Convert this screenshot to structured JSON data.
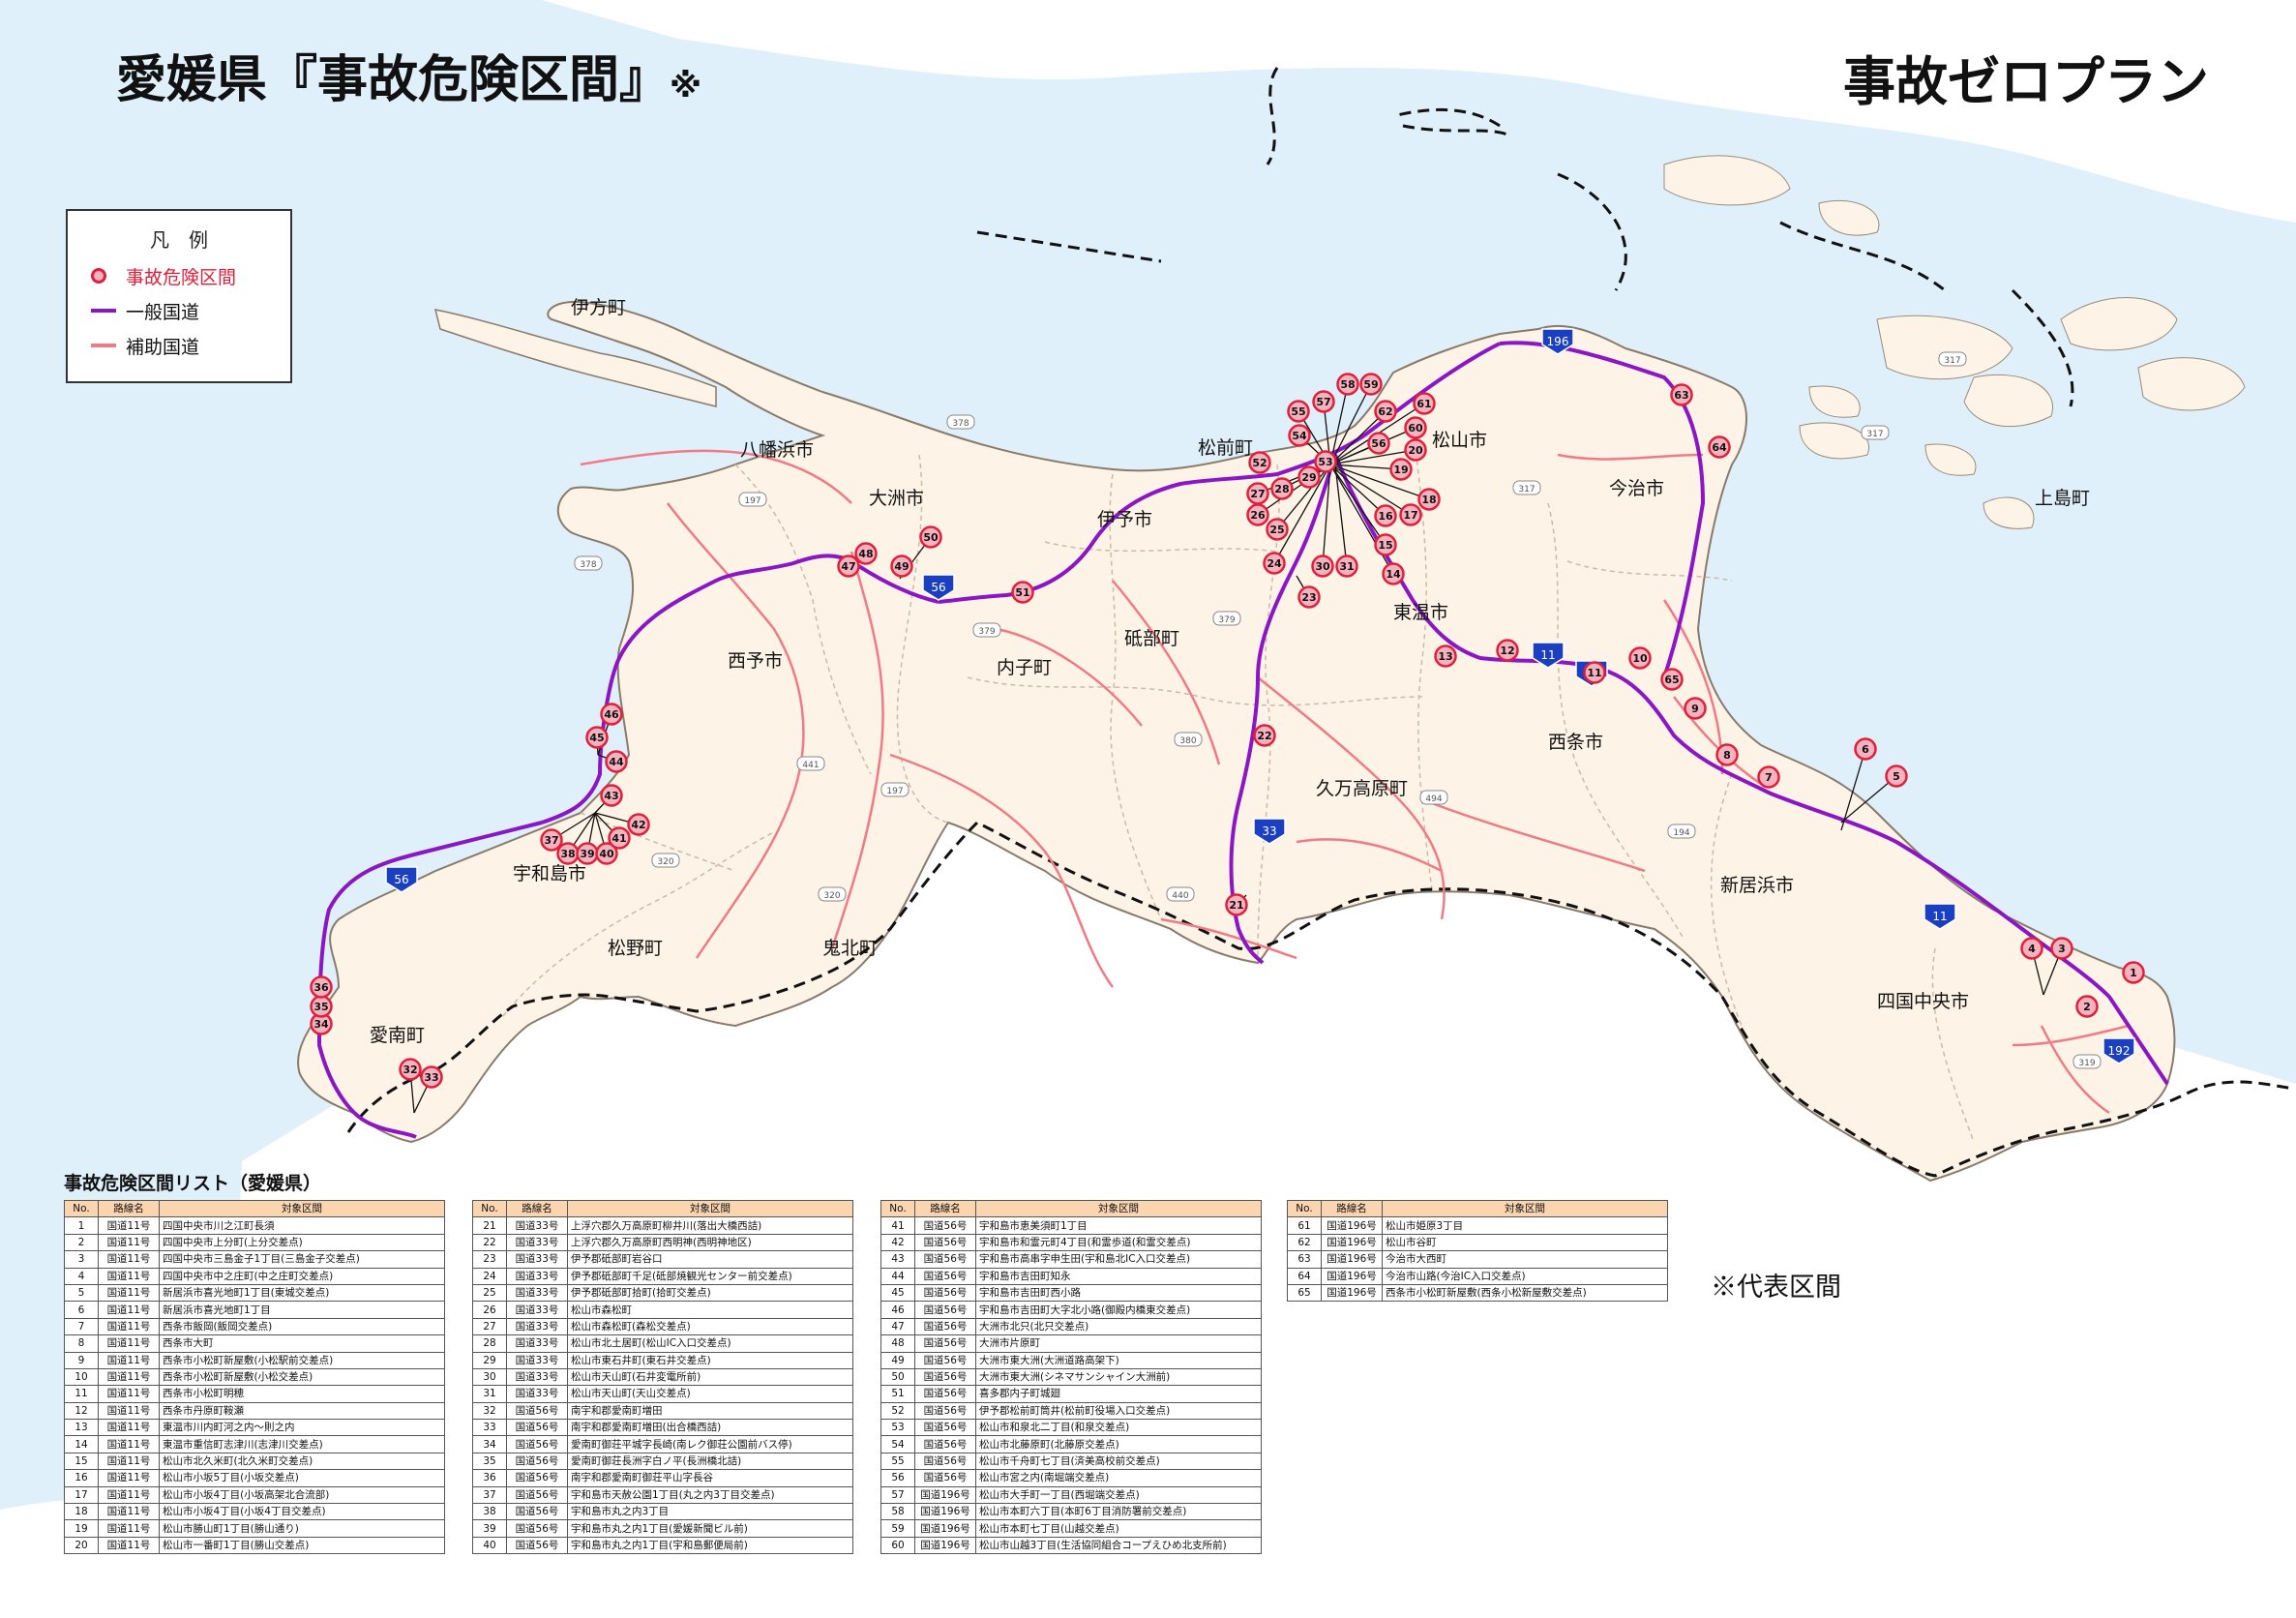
{
  "title": {
    "main": "愛媛県『事故危険区間』",
    "mark": "※",
    "plan": "事故ゼロプラン"
  },
  "legend": {
    "heading": "凡　例",
    "items": [
      {
        "label": "事故危険区間",
        "color": "#e0203a"
      },
      {
        "label": "一般国道",
        "color": "#8a16c4"
      },
      {
        "label": "補助国道",
        "color": "#f07a86"
      }
    ]
  },
  "colors": {
    "sea": "#dff0fb",
    "land": "#fdf3e6",
    "prefecture_border": "#111111",
    "municipal_border": "#cfb9a8",
    "hotspot": "#e0203a",
    "national_road": "#8a16c4",
    "sub_road": "#f07a86",
    "route_shield": "#1a3fc0"
  },
  "place_labels": [
    "伊方町",
    "八幡浜市",
    "大洲市",
    "松前町",
    "松山市",
    "今治市",
    "伊予市",
    "砥部町",
    "内子町",
    "西予市",
    "東温市",
    "西条市",
    "久万高原町",
    "宇和島市",
    "新居浜市",
    "松野町",
    "鬼北町",
    "四国中央市",
    "愛南町",
    "上島町"
  ],
  "route_shields": [
    "196",
    "56",
    "11",
    "11",
    "11",
    "33",
    "56",
    "192"
  ],
  "aux_route_numbers": [
    "378",
    "197",
    "378",
    "379",
    "379",
    "380",
    "441",
    "197",
    "494",
    "320",
    "320",
    "440",
    "194",
    "319",
    "317",
    "317",
    "317"
  ],
  "hotspot_numbers": [
    "1",
    "2",
    "3",
    "4",
    "5",
    "6",
    "7",
    "8",
    "9",
    "10",
    "11",
    "12",
    "13",
    "14",
    "15",
    "16",
    "17",
    "18",
    "19",
    "20",
    "21",
    "22",
    "23",
    "24",
    "25",
    "26",
    "27",
    "28",
    "29",
    "30",
    "31",
    "32",
    "33",
    "34",
    "35",
    "36",
    "37",
    "38",
    "39",
    "40",
    "41",
    "42",
    "43",
    "44",
    "45",
    "46",
    "47",
    "48",
    "49",
    "50",
    "51",
    "52",
    "53",
    "54",
    "55",
    "56",
    "57",
    "58",
    "59",
    "60",
    "61",
    "62",
    "63",
    "64",
    "65"
  ],
  "list": {
    "title": "事故危険区間リスト（愛媛県）",
    "headers": {
      "no": "No.",
      "route": "路線名",
      "section": "対象区間"
    },
    "tables": [
      [
        [
          "1",
          "国道11号",
          "四国中央市川之江町長須"
        ],
        [
          "2",
          "国道11号",
          "四国中央市上分町(上分交差点)"
        ],
        [
          "3",
          "国道11号",
          "四国中央市三島金子1丁目(三島金子交差点)"
        ],
        [
          "4",
          "国道11号",
          "四国中央市中之庄町(中之庄町交差点)"
        ],
        [
          "5",
          "国道11号",
          "新居浜市喜光地町1丁目(東城交差点)"
        ],
        [
          "6",
          "国道11号",
          "新居浜市喜光地町1丁目"
        ],
        [
          "7",
          "国道11号",
          "西条市飯岡(飯岡交差点)"
        ],
        [
          "8",
          "国道11号",
          "西条市大町"
        ],
        [
          "9",
          "国道11号",
          "西条市小松町新屋敷(小松駅前交差点)"
        ],
        [
          "10",
          "国道11号",
          "西条市小松町新屋敷(小松交差点)"
        ],
        [
          "11",
          "国道11号",
          "西条市小松町明穂"
        ],
        [
          "12",
          "国道11号",
          "西条市丹原町鞍瀬"
        ],
        [
          "13",
          "国道11号",
          "東温市川内町河之内～則之内"
        ],
        [
          "14",
          "国道11号",
          "東温市重信町志津川(志津川交差点)"
        ],
        [
          "15",
          "国道11号",
          "松山市北久米町(北久米町交差点)"
        ],
        [
          "16",
          "国道11号",
          "松山市小坂5丁目(小坂交差点)"
        ],
        [
          "17",
          "国道11号",
          "松山市小坂4丁目(小坂高架北合流部)"
        ],
        [
          "18",
          "国道11号",
          "松山市小坂4丁目(小坂4丁目交差点)"
        ],
        [
          "19",
          "国道11号",
          "松山市勝山町1丁目(勝山通り)"
        ],
        [
          "20",
          "国道11号",
          "松山市一番町1丁目(勝山交差点)"
        ]
      ],
      [
        [
          "21",
          "国道33号",
          "上浮穴郡久万高原町柳井川(落出大橋西詰)"
        ],
        [
          "22",
          "国道33号",
          "上浮穴郡久万高原町西明神(西明神地区)"
        ],
        [
          "23",
          "国道33号",
          "伊予郡砥部町岩谷口"
        ],
        [
          "24",
          "国道33号",
          "伊予郡砥部町千足(砥部焼観光センター前交差点)"
        ],
        [
          "25",
          "国道33号",
          "伊予郡砥部町拾町(拾町交差点)"
        ],
        [
          "26",
          "国道33号",
          "松山市森松町"
        ],
        [
          "27",
          "国道33号",
          "松山市森松町(森松交差点)"
        ],
        [
          "28",
          "国道33号",
          "松山市北土居町(松山IC入口交差点)"
        ],
        [
          "29",
          "国道33号",
          "松山市東石井町(東石井交差点)"
        ],
        [
          "30",
          "国道33号",
          "松山市天山町(石井変電所前)"
        ],
        [
          "31",
          "国道33号",
          "松山市天山町(天山交差点)"
        ],
        [
          "32",
          "国道56号",
          "南宇和郡愛南町増田"
        ],
        [
          "33",
          "国道56号",
          "南宇和郡愛南町増田(出合橋西詰)"
        ],
        [
          "34",
          "国道56号",
          "愛南町御荘平城字長崎(南レク御荘公園前バス停)"
        ],
        [
          "35",
          "国道56号",
          "愛南町御荘長洲字白ノ平(長洲橋北詰)"
        ],
        [
          "36",
          "国道56号",
          "南宇和郡愛南町御荘平山字長谷"
        ],
        [
          "37",
          "国道56号",
          "宇和島市天赦公園1丁目(丸之内3丁目交差点)"
        ],
        [
          "38",
          "国道56号",
          "宇和島市丸之内3丁目"
        ],
        [
          "39",
          "国道56号",
          "宇和島市丸之内1丁目(愛媛新聞ビル前)"
        ],
        [
          "40",
          "国道56号",
          "宇和島市丸之内1丁目(宇和島郵便局前)"
        ]
      ],
      [
        [
          "41",
          "国道56号",
          "宇和島市恵美須町1丁目"
        ],
        [
          "42",
          "国道56号",
          "宇和島市和霊元町4丁目(和霊歩道(和霊交差点)"
        ],
        [
          "43",
          "国道56号",
          "宇和島市高串字申生田(宇和島北IC入口交差点)"
        ],
        [
          "44",
          "国道56号",
          "宇和島市吉田町知永"
        ],
        [
          "45",
          "国道56号",
          "宇和島市吉田町西小路"
        ],
        [
          "46",
          "国道56号",
          "宇和島市吉田町大字北小路(御殿内橋東交差点)"
        ],
        [
          "47",
          "国道56号",
          "大洲市北只(北只交差点)"
        ],
        [
          "48",
          "国道56号",
          "大洲市片原町"
        ],
        [
          "49",
          "国道56号",
          "大洲市東大洲(大洲道路高架下)"
        ],
        [
          "50",
          "国道56号",
          "大洲市東大洲(シネマサンシャイン大洲前)"
        ],
        [
          "51",
          "国道56号",
          "喜多郡内子町城廻"
        ],
        [
          "52",
          "国道56号",
          "伊予郡松前町筒井(松前町役場入口交差点)"
        ],
        [
          "53",
          "国道56号",
          "松山市和泉北二丁目(和泉交差点)"
        ],
        [
          "54",
          "国道56号",
          "松山市北藤原町(北藤原交差点)"
        ],
        [
          "55",
          "国道56号",
          "松山市千舟町七丁目(済美高校前交差点)"
        ],
        [
          "56",
          "国道56号",
          "松山市宮之内(南堀端交差点)"
        ],
        [
          "57",
          "国道196号",
          "松山市大手町一丁目(西堀端交差点)"
        ],
        [
          "58",
          "国道196号",
          "松山市本町六丁目(本町6丁目消防署前交差点)"
        ],
        [
          "59",
          "国道196号",
          "松山市本町七丁目(山越交差点)"
        ],
        [
          "60",
          "国道196号",
          "松山市山越3丁目(生活協同組合コープえひめ北支所前)"
        ]
      ],
      [
        [
          "61",
          "国道196号",
          "松山市姫原3丁目"
        ],
        [
          "62",
          "国道196号",
          "松山市谷町"
        ],
        [
          "63",
          "国道196号",
          "今治市大西町"
        ],
        [
          "64",
          "国道196号",
          "今治市山路(今治IC入口交差点)"
        ],
        [
          "65",
          "国道196号",
          "西条市小松町新屋敷(西条小松新屋敷交差点)"
        ]
      ]
    ]
  },
  "note": "※代表区間"
}
